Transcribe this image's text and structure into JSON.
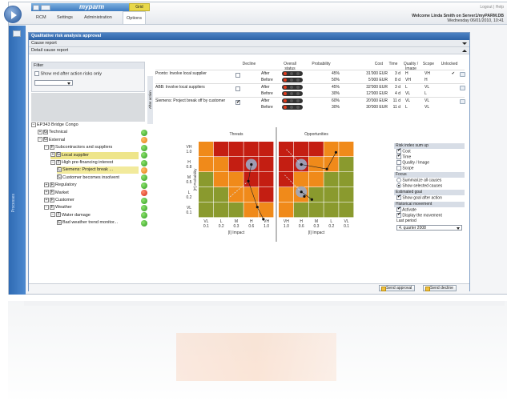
{
  "app": {
    "logo": "myparm",
    "quick_access": [
      "save-icon",
      "dropdown-icon"
    ],
    "grid_tab": "Grid"
  },
  "menu": {
    "tabs": [
      "RCM",
      "Settings",
      "Administration",
      "Options"
    ],
    "active": "Options"
  },
  "top_right": {
    "links": "Logout | Help",
    "welcome": "Welcome Linda Smith on Server1/myPARM.DB",
    "date": "Wednesday 06/01/2010, 10:41"
  },
  "sidebar": {
    "label": "Processes"
  },
  "main": {
    "title": "Qualitative risk analysis approval",
    "sections": [
      "Cause report",
      "Detail cause report"
    ]
  },
  "filter": {
    "title": "Filter",
    "show_red": "Show red after action risks only",
    "show_red_checked": false,
    "select_value": ""
  },
  "tree": [
    {
      "label": "EP343 Bridge Congo",
      "type": "",
      "expander": "−",
      "indent": 0,
      "status": null
    },
    {
      "label": "Technical",
      "type": "G",
      "expander": "+",
      "indent": 1,
      "status": "green"
    },
    {
      "label": "External",
      "type": "G",
      "expander": "−",
      "indent": 1,
      "status": "orange"
    },
    {
      "label": "Subcontractors and suppliers",
      "type": "F",
      "expander": "−",
      "indent": 2,
      "status": "green"
    },
    {
      "label": "Local supplier",
      "type": "G",
      "expander": "+",
      "indent": 3,
      "status": "green",
      "highlight": "hl"
    },
    {
      "label": "High pre-financing interest",
      "type": "T",
      "expander": "−",
      "indent": 3,
      "status": "green"
    },
    {
      "label": "Siemens: Project break ...",
      "type": "C",
      "expander": "",
      "indent": 4,
      "status": "orange",
      "highlight": "hl2"
    },
    {
      "label": "Customer becomes insolvent",
      "type": "C",
      "expander": "",
      "indent": 4,
      "status": "green"
    },
    {
      "label": "Regulatory",
      "type": "F",
      "expander": "+",
      "indent": 2,
      "status": "green"
    },
    {
      "label": "Market",
      "type": "F",
      "expander": "+",
      "indent": 2,
      "status": "red"
    },
    {
      "label": "Customer",
      "type": "F",
      "expander": "+",
      "indent": 2,
      "status": "green"
    },
    {
      "label": "Weather",
      "type": "F",
      "expander": "−",
      "indent": 2,
      "status": "green"
    },
    {
      "label": "Water damage",
      "type": "T",
      "expander": "−",
      "indent": 3,
      "status": "green"
    },
    {
      "label": "Bad weather trend monitor...",
      "type": "C",
      "expander": "",
      "indent": 4,
      "status": "green"
    }
  ],
  "actions_table": {
    "headers": [
      "Decline",
      "Overall status",
      "Probability",
      "Cost",
      "Time",
      "Quality / Image",
      "Scope",
      "Unlocked"
    ],
    "side_label": "After action",
    "rows": [
      {
        "cause": "Pronto: Involve local supplier",
        "decline": false,
        "after": {
          "prob": "45%",
          "cost": "31'000 EUR",
          "time": "3 d",
          "quality": "H",
          "scope": "VH"
        },
        "before": {
          "prob": "50%",
          "cost": "5'000 EUR",
          "time": "8 d",
          "quality": "VH",
          "scope": "H"
        },
        "unlocked": true
      },
      {
        "cause": "ABB: Involve local suppliers",
        "decline": false,
        "after": {
          "prob": "45%",
          "cost": "32'000 EUR",
          "time": "3 d",
          "quality": "L",
          "scope": "VL"
        },
        "before": {
          "prob": "30%",
          "cost": "12'000 EUR",
          "time": "4 d",
          "quality": "VL",
          "scope": "L"
        },
        "unlocked": false
      },
      {
        "cause": "Siemens: Project break off by customer",
        "decline": true,
        "after": {
          "prob": "60%",
          "cost": "20'000 EUR",
          "time": "11 d",
          "quality": "VL",
          "scope": "VL"
        },
        "before": {
          "prob": "30%",
          "cost": "30'000 EUR",
          "time": "11 d",
          "quality": "L",
          "scope": "VL"
        },
        "unlocked": false
      }
    ],
    "labels": {
      "after": "After",
      "before": "Before"
    }
  },
  "matrix": {
    "threats": "Threats",
    "opportunities": "Opportunities",
    "y_axis": "[P] Probability",
    "x_axis": "[I] Impact",
    "y_ticks": [
      [
        "VH",
        "1.0"
      ],
      [
        "H",
        "0.8"
      ],
      [
        "M",
        "0.5"
      ],
      [
        "L",
        "0.2"
      ],
      [
        "VL",
        "0.1"
      ]
    ],
    "x_ticks": [
      [
        "VL",
        "0.1"
      ],
      [
        "L",
        "0.2"
      ],
      [
        "M",
        "0.3"
      ],
      [
        "H",
        "0.6"
      ],
      [
        "VH",
        "1.0"
      ],
      [
        "VH",
        "1.0"
      ],
      [
        "H",
        "0.6"
      ],
      [
        "M",
        "0.3"
      ],
      [
        "L",
        "0.2"
      ],
      [
        "VL",
        "0.1"
      ]
    ],
    "colors": {
      "red": "#c41e12",
      "orange": "#f08a1a",
      "olive": "#8a9a2e",
      "grey": "#9aa9c4"
    },
    "threat_grid": [
      [
        "o",
        "r",
        "r",
        "r",
        "r"
      ],
      [
        "o",
        "o",
        "r",
        "r",
        "r"
      ],
      [
        "v",
        "o",
        "o",
        "r",
        "r"
      ],
      [
        "v",
        "v",
        "o",
        "o",
        "r"
      ],
      [
        "v",
        "v",
        "v",
        "o",
        "o"
      ]
    ],
    "opp_grid": [
      [
        "r",
        "r",
        "r",
        "o",
        "o"
      ],
      [
        "r",
        "r",
        "o",
        "o",
        "v"
      ],
      [
        "r",
        "o",
        "o",
        "v",
        "v"
      ],
      [
        "o",
        "o",
        "v",
        "v",
        "v"
      ],
      [
        "o",
        "v",
        "v",
        "v",
        "v"
      ]
    ]
  },
  "right_panel": {
    "risk_index": {
      "title": "Risk index sum up",
      "items": [
        {
          "label": "Cost",
          "checked": true
        },
        {
          "label": "Time",
          "checked": true
        },
        {
          "label": "Quality / Image",
          "checked": false
        },
        {
          "label": "Scope",
          "checked": false
        }
      ]
    },
    "focus": {
      "title": "Focus",
      "items": [
        {
          "label": "Summarize all causes",
          "on": false
        },
        {
          "label": "Show selected causes",
          "on": true
        }
      ]
    },
    "estimated_goal": {
      "title": "Estimated goal",
      "items": [
        {
          "label": "Show goal after action",
          "checked": true
        }
      ]
    },
    "historical": {
      "title": "Historical movement",
      "items": [
        {
          "label": "Activate",
          "checked": true
        },
        {
          "label": "Display the movement",
          "checked": true
        }
      ],
      "last_period_label": "Last period",
      "last_period_value": "4. quarter 2008"
    }
  },
  "buttons": {
    "send_approval": "Send approval",
    "send_decline": "Send decline"
  }
}
